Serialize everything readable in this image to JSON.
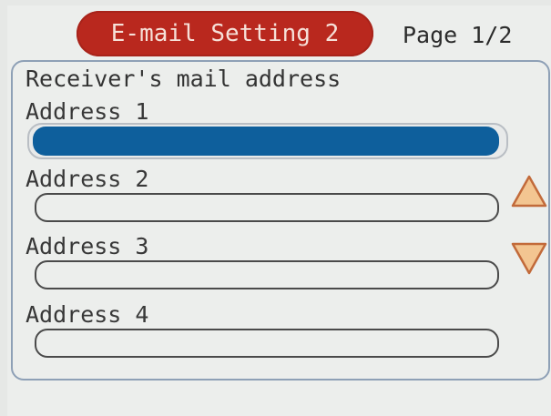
{
  "header": {
    "title": "E-mail Setting 2",
    "page_indicator": "Page 1/2"
  },
  "form": {
    "heading": "Receiver's mail address",
    "fields": [
      {
        "label": "Address 1",
        "value": "",
        "selected": true
      },
      {
        "label": "Address 2",
        "value": ""
      },
      {
        "label": "Address 3",
        "value": ""
      },
      {
        "label": "Address 4",
        "value": ""
      }
    ]
  },
  "controls": {
    "up_icon": "triangle-up-icon",
    "down_icon": "triangle-down-icon"
  },
  "colors": {
    "title_pill": "#b9281e",
    "selected_field": "#0e5f9c",
    "arrow_fill": "#f3c591",
    "arrow_stroke": "#c26a3a",
    "panel_border": "#8ea0b6"
  }
}
